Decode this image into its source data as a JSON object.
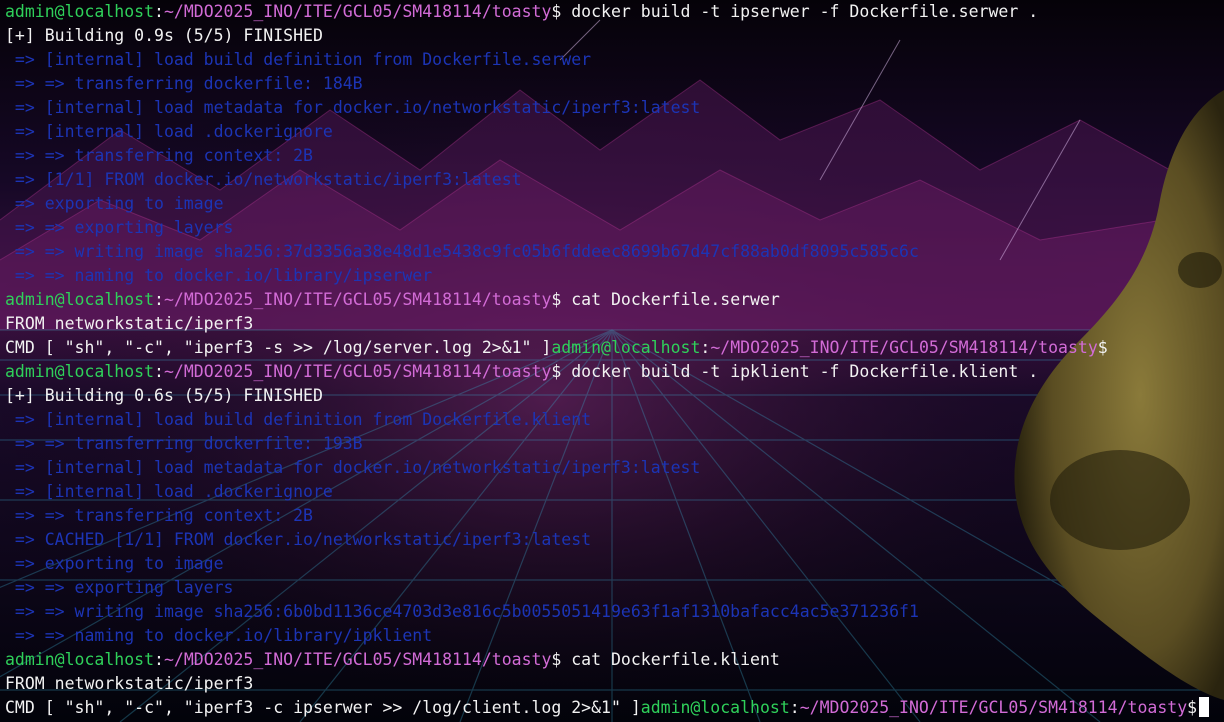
{
  "prompt": {
    "user_host": "admin@localhost",
    "sep": ":",
    "path": "~/MDO2025_INO/ITE/GCL05/SM418114/toasty",
    "symbol": "$"
  },
  "commands": {
    "build_serwer": " docker build -t ipserwer -f Dockerfile.serwer .",
    "cat_serwer": " cat Dockerfile.serwer",
    "build_klient": " docker build -t ipklient -f Dockerfile.klient .",
    "cat_klient": " cat Dockerfile.klient"
  },
  "build1": {
    "status": "[+] Building 0.9s (5/5) FINISHED",
    "steps": [
      " => [internal] load build definition from Dockerfile.serwer",
      " => => transferring dockerfile: 184B",
      " => [internal] load metadata for docker.io/networkstatic/iperf3:latest",
      " => [internal] load .dockerignore",
      " => => transferring context: 2B",
      " => [1/1] FROM docker.io/networkstatic/iperf3:latest",
      " => exporting to image",
      " => => exporting layers",
      " => => writing image sha256:37d3356a38e48d1e5438c9fc05b6fddeec8699b67d47cf88ab0df8095c585c6c",
      " => => naming to docker.io/library/ipserwer"
    ]
  },
  "file_serwer": {
    "from": "FROM networkstatic/iperf3",
    "cmd": "CMD [ \"sh\", \"-c\", \"iperf3 -s >> /log/server.log 2>&1\" ]"
  },
  "build2": {
    "status": "[+] Building 0.6s (5/5) FINISHED",
    "steps": [
      " => [internal] load build definition from Dockerfile.klient",
      " => => transferring dockerfile: 193B",
      " => [internal] load metadata for docker.io/networkstatic/iperf3:latest",
      " => [internal] load .dockerignore",
      " => => transferring context: 2B",
      " => CACHED [1/1] FROM docker.io/networkstatic/iperf3:latest",
      " => exporting to image",
      " => => exporting layers",
      " => => writing image sha256:6b0bd1136ce4703d3e816c5b0055051419e63f1af1310bafacc4ac5e371236f1",
      " => => naming to docker.io/library/ipklient"
    ]
  },
  "file_klient": {
    "from": "FROM networkstatic/iperf3",
    "cmd": "CMD [ \"sh\", \"-c\", \"iperf3 -c ipserwer >> /log/client.log 2>&1\" ]"
  },
  "colors": {
    "prompt_user": "#2fd05a",
    "prompt_path": "#d26bd6",
    "dim_output": "#1c34b5",
    "text": "#f2f2f2"
  }
}
